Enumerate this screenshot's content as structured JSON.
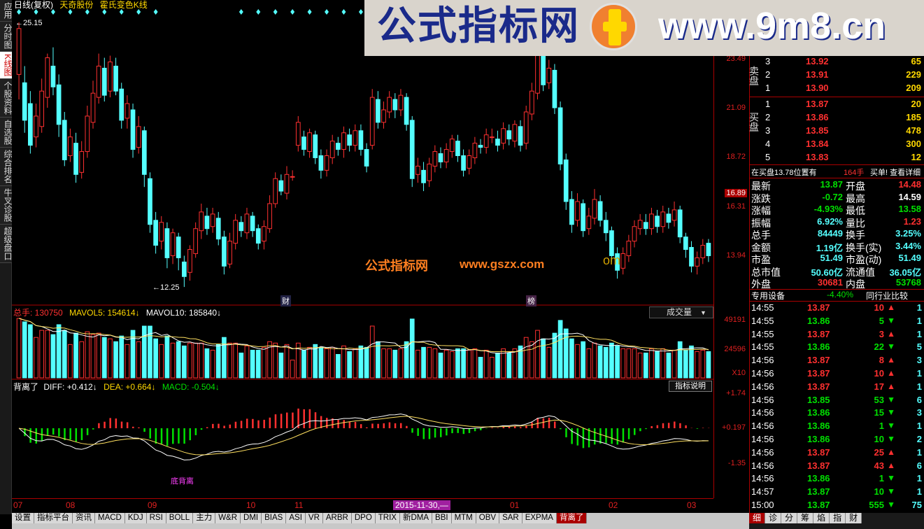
{
  "header": {
    "period": "日线(复权)",
    "stock_name": "天奇股份",
    "indicator_name": "霍氏变色K线",
    "high_marker": "25.15",
    "low_marker": "12.25"
  },
  "left_tabs": [
    "应用",
    "分时图",
    "K线图",
    "个股资料",
    "自选股",
    "综合排名",
    "牛叉诊股",
    "超级盘口"
  ],
  "price_axis": {
    "ticks": [
      "23.49",
      "21.09",
      "18.72",
      "16.31",
      "13.94"
    ],
    "current": "16.89",
    "volume_ticks": [
      "49191",
      "24596",
      "X10"
    ],
    "macd_ticks": [
      "+1.74",
      "+0.197",
      "-1.35"
    ]
  },
  "volume_header": {
    "total_label": "总手: 130750",
    "mavol5": "MAVOL5: 154614",
    "mavol10": "MAVOL10: 185840",
    "dropdown": "成交量"
  },
  "macd_header": {
    "name": "背离了",
    "diff": "DIFF: +0.412",
    "dea": "DEA: +0.664",
    "macd": "MACD: -0.504",
    "button": "指标说明",
    "annotation": "底背离"
  },
  "chart_marks": {
    "fin": "财",
    "bang": "榜"
  },
  "overlay_text": {
    "ad1": "公式指标网",
    "ad2": "www.gszx.com",
    "ad3": "om",
    "banner": "公式指标网",
    "banner_url": "www.9m8.cn"
  },
  "time_axis": {
    "labels": [
      "07",
      "08",
      "09",
      "10",
      "11",
      "01",
      "02",
      "03"
    ],
    "cursor": "2015-11-30,—"
  },
  "bottom_tabs": [
    "设置",
    "指标平台",
    "资讯",
    "MACD",
    "KDJ",
    "RSI",
    "BOLL",
    "主力",
    "W&R",
    "DMI",
    "BIAS",
    "ASI",
    "VR",
    "ARBR",
    "DPO",
    "TRIX",
    "新DMA",
    "BBI",
    "MTM",
    "OBV",
    "SAR",
    "EXPMA",
    "背离了"
  ],
  "right_tabs": [
    "细",
    "诊",
    "分",
    "筹",
    "焰",
    "指",
    "财"
  ],
  "order_book": {
    "sell_label": "卖盘",
    "buy_label": "买盘",
    "sell": [
      {
        "level": "3",
        "price": "13.92",
        "vol": "65"
      },
      {
        "level": "2",
        "price": "13.91",
        "vol": "229"
      },
      {
        "level": "1",
        "price": "13.90",
        "vol": "209"
      }
    ],
    "buy": [
      {
        "level": "1",
        "price": "13.87",
        "vol": "20"
      },
      {
        "level": "2",
        "price": "13.86",
        "vol": "185"
      },
      {
        "level": "3",
        "price": "13.85",
        "vol": "478"
      },
      {
        "level": "4",
        "price": "13.84",
        "vol": "300"
      },
      {
        "level": "5",
        "price": "13.83",
        "vol": "12"
      }
    ],
    "info_line": "在买盘13.78位置有",
    "info_qty": "164手",
    "info_link": "买单! 查看详细"
  },
  "quote": [
    {
      "l": "最新",
      "v": "13.87",
      "l2": "开盘",
      "v2": "14.48"
    },
    {
      "l": "涨跌",
      "v": "-0.72",
      "l2": "最高",
      "v2": "14.59"
    },
    {
      "l": "涨幅",
      "v": "-4.93%",
      "l2": "最低",
      "v2": "13.58"
    },
    {
      "l": "振幅",
      "v": "6.92%",
      "l2": "量比",
      "v2": "1.23"
    },
    {
      "l": "总手",
      "v": "84449",
      "l2": "换手",
      "v2": "3.25%"
    },
    {
      "l": "金额",
      "v": "1.19亿",
      "l2": "换手(实)",
      "v2": "3.44%"
    },
    {
      "l": "市盈",
      "v": "51.49",
      "l2": "市盈(动)",
      "v2": "51.49"
    },
    {
      "l": "总市值",
      "v": "50.60亿",
      "l2": "流通值",
      "v2": "36.05亿"
    },
    {
      "l": "外盘",
      "v": "30681",
      "l2": "内盘",
      "v2": "53768"
    }
  ],
  "industry": {
    "name": "专用设备",
    "change": "-4.40%",
    "link": "同行业比较"
  },
  "ticks": [
    {
      "t": "14:55",
      "p": "13.87",
      "v": "10",
      "d": "up",
      "n": "1"
    },
    {
      "t": "14:55",
      "p": "13.86",
      "v": "5",
      "d": "down",
      "n": "1"
    },
    {
      "t": "14:55",
      "p": "13.87",
      "v": "3",
      "d": "up",
      "n": "1"
    },
    {
      "t": "14:55",
      "p": "13.86",
      "v": "22",
      "d": "down",
      "n": "5"
    },
    {
      "t": "14:56",
      "p": "13.87",
      "v": "8",
      "d": "up",
      "n": "3"
    },
    {
      "t": "14:56",
      "p": "13.87",
      "v": "10",
      "d": "up",
      "n": "1"
    },
    {
      "t": "14:56",
      "p": "13.87",
      "v": "17",
      "d": "up",
      "n": "1"
    },
    {
      "t": "14:56",
      "p": "13.85",
      "v": "53",
      "d": "down",
      "n": "6"
    },
    {
      "t": "14:56",
      "p": "13.86",
      "v": "15",
      "d": "down",
      "n": "3"
    },
    {
      "t": "14:56",
      "p": "13.86",
      "v": "1",
      "d": "down",
      "n": "1"
    },
    {
      "t": "14:56",
      "p": "13.86",
      "v": "10",
      "d": "down",
      "n": "2"
    },
    {
      "t": "14:56",
      "p": "13.87",
      "v": "25",
      "d": "up",
      "n": "1"
    },
    {
      "t": "14:56",
      "p": "13.87",
      "v": "43",
      "d": "up",
      "n": "6"
    },
    {
      "t": "14:56",
      "p": "13.86",
      "v": "1",
      "d": "down",
      "n": "1"
    },
    {
      "t": "14:57",
      "p": "13.87",
      "v": "10",
      "d": "down",
      "n": "1"
    },
    {
      "t": "15:00",
      "p": "13.87",
      "v": "555",
      "d": "down",
      "n": "75"
    }
  ],
  "colors": {
    "up": "#ff3030",
    "down": "#54ffff",
    "panel_border": "#aa0000"
  },
  "chart_data": {
    "type": "candlestick",
    "candles": [
      [
        22.6,
        24.8,
        21.4,
        25.1
      ],
      [
        22.2,
        20.4,
        19.8,
        23.0
      ],
      [
        21.2,
        19.2,
        18.8,
        21.8
      ],
      [
        19.6,
        20.6,
        19.1,
        21.2
      ],
      [
        20.1,
        21.8,
        19.8,
        22.4
      ],
      [
        21.5,
        23.4,
        21.0,
        23.6
      ],
      [
        23.0,
        22.0,
        21.6,
        23.9
      ],
      [
        22.1,
        20.2,
        19.6,
        22.6
      ],
      [
        20.4,
        18.5,
        18.2,
        20.8
      ],
      [
        18.7,
        19.6,
        18.4,
        20.0
      ],
      [
        19.3,
        17.8,
        17.4,
        19.8
      ],
      [
        17.9,
        18.9,
        17.6,
        19.4
      ],
      [
        18.9,
        20.6,
        18.6,
        21.1
      ],
      [
        20.3,
        21.7,
        20.0,
        22.3
      ],
      [
        21.5,
        23.0,
        21.2,
        23.6
      ],
      [
        22.9,
        21.6,
        21.3,
        23.4
      ],
      [
        21.8,
        23.2,
        21.5,
        23.5
      ],
      [
        23.0,
        21.8,
        21.6,
        23.4
      ],
      [
        21.9,
        20.4,
        20.0,
        22.2
      ],
      [
        20.5,
        21.2,
        20.0,
        21.6
      ],
      [
        20.9,
        19.0,
        18.6,
        21.2
      ],
      [
        19.1,
        20.1,
        18.8,
        20.6
      ],
      [
        19.9,
        17.8,
        17.2,
        20.1
      ],
      [
        17.6,
        15.4,
        15.0,
        17.9
      ],
      [
        15.6,
        14.4,
        14.0,
        16.0
      ],
      [
        14.6,
        15.5,
        14.2,
        15.8
      ],
      [
        15.2,
        13.8,
        13.3,
        15.5
      ],
      [
        13.9,
        15.0,
        13.5,
        15.2
      ],
      [
        14.8,
        13.8,
        13.2,
        15.0
      ],
      [
        13.6,
        12.9,
        12.4,
        13.9
      ],
      [
        13.1,
        14.2,
        12.7,
        14.4
      ],
      [
        14.0,
        15.2,
        13.8,
        15.5
      ],
      [
        15.1,
        16.0,
        14.7,
        16.4
      ],
      [
        15.8,
        15.2,
        14.9,
        16.2
      ],
      [
        15.3,
        15.9,
        15.0,
        16.2
      ],
      [
        15.7,
        14.7,
        14.4,
        16.0
      ],
      [
        14.8,
        13.4,
        13.0,
        15.1
      ],
      [
        13.5,
        14.6,
        13.3,
        15.0
      ],
      [
        14.5,
        15.6,
        14.2,
        15.9
      ],
      [
        15.5,
        15.1,
        14.8,
        15.8
      ],
      [
        15.0,
        15.9,
        14.7,
        16.2
      ],
      [
        15.8,
        15.1,
        14.8,
        16.0
      ],
      [
        15.2,
        14.5,
        14.2,
        15.4
      ],
      [
        14.6,
        15.3,
        14.2,
        15.6
      ],
      [
        15.2,
        16.4,
        15.0,
        16.8
      ],
      [
        16.4,
        17.6,
        16.2,
        17.9
      ],
      [
        17.5,
        17.0,
        16.8,
        17.8
      ],
      [
        16.9,
        17.8,
        16.6,
        18.2
      ],
      [
        17.7,
        17.7,
        17.5,
        18.0
      ],
      [
        19.2,
        20.3,
        18.9,
        20.6
      ],
      [
        19.6,
        19.0,
        18.7,
        19.9
      ],
      [
        18.9,
        19.8,
        18.6,
        20.0
      ],
      [
        19.7,
        18.6,
        18.3,
        19.9
      ],
      [
        18.7,
        18.0,
        17.6,
        19.0
      ],
      [
        18.0,
        18.7,
        17.7,
        19.0
      ],
      [
        18.6,
        19.4,
        18.3,
        19.7
      ],
      [
        19.3,
        19.0,
        18.7,
        19.6
      ],
      [
        19.0,
        19.8,
        18.6,
        20.1
      ],
      [
        19.7,
        19.2,
        18.9,
        20.0
      ],
      [
        19.2,
        19.9,
        18.9,
        20.2
      ],
      [
        19.9,
        19.0,
        18.7,
        20.2
      ],
      [
        19.0,
        18.2,
        17.9,
        19.3
      ],
      [
        19.2,
        21.5,
        19.0,
        21.9
      ],
      [
        21.4,
        20.3,
        20.0,
        21.8
      ],
      [
        20.3,
        20.9,
        20.0,
        21.3
      ],
      [
        20.8,
        21.5,
        20.5,
        21.8
      ],
      [
        21.4,
        20.9,
        20.5,
        21.7
      ],
      [
        20.9,
        21.6,
        20.6,
        21.9
      ],
      [
        21.5,
        20.2,
        19.9,
        21.7
      ],
      [
        20.4,
        17.6,
        17.2,
        20.6
      ],
      [
        17.8,
        18.2,
        17.4,
        18.6
      ],
      [
        18.0,
        17.4,
        17.0,
        18.4
      ],
      [
        17.5,
        18.3,
        17.2,
        18.6
      ],
      [
        18.2,
        18.9,
        17.9,
        19.2
      ],
      [
        18.8,
        18.4,
        18.1,
        19.1
      ],
      [
        18.4,
        19.0,
        18.1,
        19.3
      ],
      [
        18.9,
        19.5,
        18.6,
        19.7
      ],
      [
        19.4,
        18.7,
        18.4,
        19.7
      ],
      [
        18.7,
        18.0,
        17.7,
        19.0
      ],
      [
        18.1,
        18.7,
        17.8,
        19.0
      ],
      [
        18.6,
        19.3,
        18.3,
        19.6
      ],
      [
        19.2,
        19.1,
        18.8,
        19.5
      ],
      [
        19.1,
        19.7,
        18.8,
        20.0
      ],
      [
        19.6,
        19.6,
        19.3,
        20.0
      ],
      [
        19.5,
        19.2,
        18.9,
        19.9
      ],
      [
        19.3,
        20.0,
        19.0,
        20.3
      ],
      [
        19.9,
        19.5,
        19.2,
        20.2
      ],
      [
        19.4,
        20.2,
        19.1,
        20.4
      ],
      [
        20.1,
        19.2,
        18.9,
        20.4
      ],
      [
        19.3,
        20.8,
        19.0,
        21.1
      ],
      [
        20.7,
        21.8,
        20.4,
        22.2
      ],
      [
        21.7,
        23.6,
        21.4,
        24.0
      ],
      [
        23.5,
        22.1,
        21.8,
        23.8
      ],
      [
        22.2,
        22.9,
        21.9,
        23.3
      ],
      [
        22.8,
        21.0,
        20.7,
        23.1
      ],
      [
        21.0,
        18.3,
        18.0,
        21.3
      ],
      [
        18.5,
        16.5,
        16.1,
        18.8
      ],
      [
        16.6,
        15.4,
        15.0,
        17.0
      ],
      [
        15.6,
        16.5,
        15.3,
        16.9
      ],
      [
        16.4,
        15.1,
        14.8,
        16.6
      ],
      [
        15.2,
        15.8,
        14.9,
        16.2
      ],
      [
        15.7,
        16.6,
        15.4,
        17.1
      ],
      [
        16.5,
        15.6,
        15.3,
        16.8
      ],
      [
        15.6,
        15.0,
        14.6,
        16.0
      ],
      [
        15.1,
        13.9,
        13.6,
        15.3
      ],
      [
        14.0,
        13.2,
        12.8,
        14.3
      ],
      [
        13.3,
        14.0,
        13.0,
        14.3
      ],
      [
        13.9,
        14.6,
        13.6,
        14.9
      ],
      [
        14.6,
        15.3,
        14.3,
        15.6
      ],
      [
        15.2,
        15.6,
        14.9,
        15.9
      ],
      [
        15.5,
        15.2,
        14.9,
        15.9
      ],
      [
        15.2,
        15.9,
        14.9,
        16.2
      ],
      [
        15.8,
        15.3,
        15.0,
        16.1
      ],
      [
        15.3,
        16.0,
        15.0,
        16.3
      ],
      [
        15.9,
        15.5,
        15.2,
        16.2
      ],
      [
        15.6,
        16.1,
        15.3,
        16.5
      ],
      [
        16.1,
        14.8,
        14.5,
        16.3
      ],
      [
        14.8,
        14.2,
        13.8,
        15.0
      ],
      [
        14.3,
        13.4,
        13.1,
        14.6
      ],
      [
        13.4,
        13.8,
        13.0,
        14.1
      ],
      [
        13.8,
        14.4,
        13.5,
        14.7
      ],
      [
        14.5,
        13.9,
        13.6,
        14.7
      ]
    ]
  }
}
